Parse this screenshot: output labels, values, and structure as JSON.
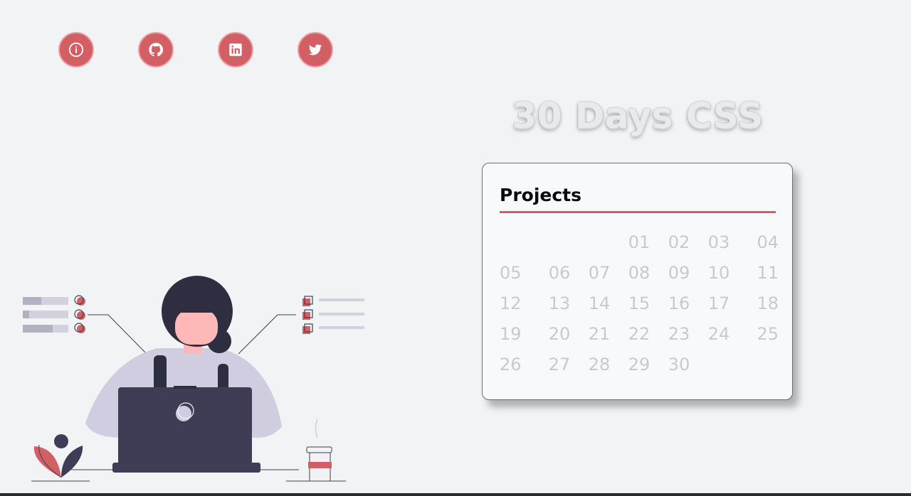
{
  "theme": {
    "accent": "#d25f63",
    "muted_text": "#cacacd"
  },
  "social": [
    {
      "name": "info",
      "icon": "info-icon"
    },
    {
      "name": "github",
      "icon": "github-icon"
    },
    {
      "name": "linkedin",
      "icon": "linkedin-icon"
    },
    {
      "name": "twitter",
      "icon": "twitter-icon"
    }
  ],
  "header": {
    "title": "30 Days CSS"
  },
  "card": {
    "title": "Projects",
    "leading_blanks": 3,
    "days": [
      "01",
      "02",
      "03",
      "04",
      "05",
      "06",
      "07",
      "08",
      "09",
      "10",
      "11",
      "12",
      "13",
      "14",
      "15",
      "16",
      "17",
      "18",
      "19",
      "20",
      "21",
      "22",
      "23",
      "24",
      "25",
      "26",
      "27",
      "28",
      "29",
      "30"
    ]
  }
}
